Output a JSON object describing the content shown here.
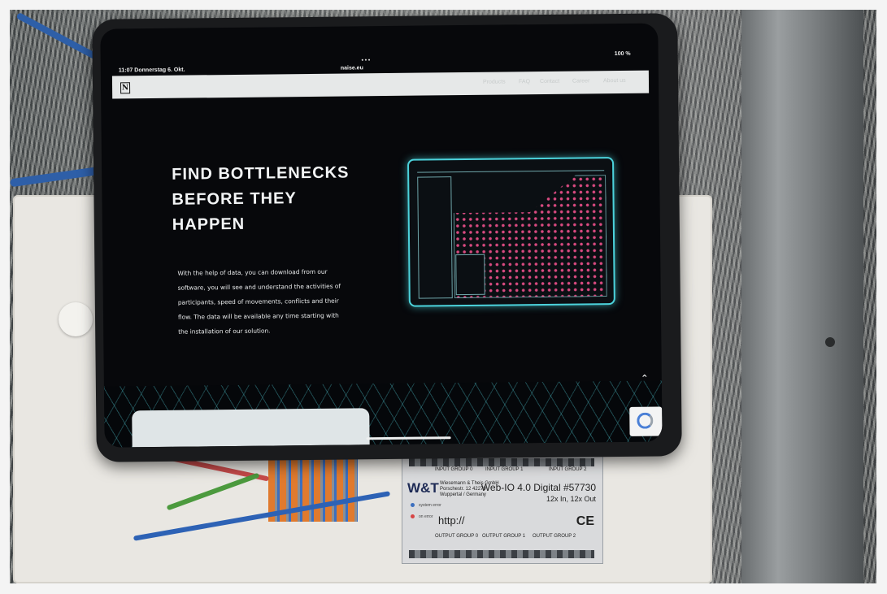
{
  "tablet": {
    "status": {
      "time": "11:07  Donnerstag 6. Okt.",
      "url": "naise.eu",
      "battery": "100 %"
    },
    "nav": {
      "items": [
        "Products",
        "FAQ",
        "Contact",
        "Career",
        "About us"
      ]
    },
    "hero": {
      "title": "FIND BOTTLENECKS BEFORE THEY HAPPEN",
      "body": "With the help of data, you can download from our software, you will see and understand the activities of participants, speed of movements, conflicts and their flow. The data will be available any time starting with the installation of our solution."
    }
  },
  "module": {
    "brand": "W&T",
    "maker": "Wiesemann & Theis GmbH Porschestr. 12 42279 Wuppertal / Germany",
    "model": "Web-IO 4.0 Digital #57730",
    "io": "12x In, 12x Out",
    "http": "http://",
    "ce": "CE",
    "system_error": "system error",
    "on_error": "on error",
    "groups_top": [
      "INPUT GROUP 0",
      "INPUT GROUP 1",
      "INPUT GROUP 2"
    ],
    "groups_bottom": [
      "OUTPUT GROUP 0",
      "OUTPUT GROUP 1",
      "OUTPUT GROUP 2"
    ]
  }
}
